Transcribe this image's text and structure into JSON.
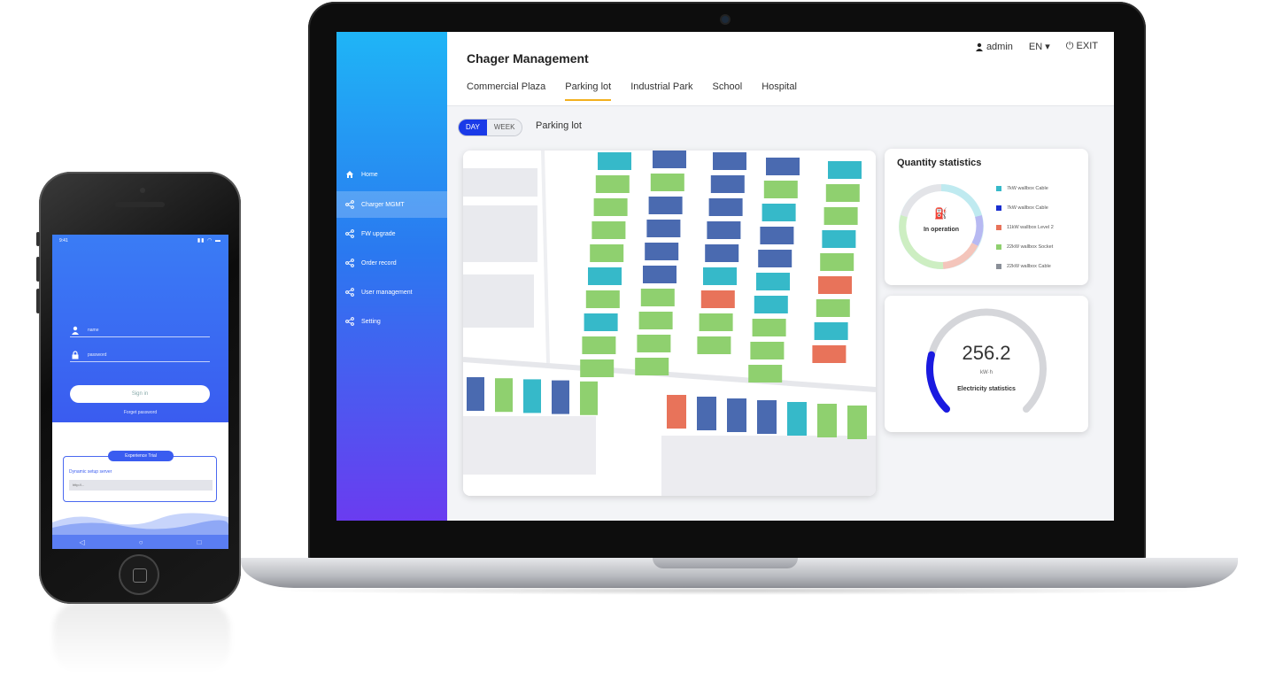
{
  "laptop": {
    "header": {
      "title": "Chager Management",
      "user": "admin",
      "language": "EN",
      "exit_label": "EXIT"
    },
    "tabs": [
      "Commercial Plaza",
      "Parking lot",
      "Industrial Park",
      "School",
      "Hospital"
    ],
    "active_tab": "Parking lot",
    "sidebar": {
      "items": [
        {
          "label": "Home",
          "icon": "home-icon"
        },
        {
          "label": "Charger MGMT",
          "icon": "share-icon"
        },
        {
          "label": "FW upgrade",
          "icon": "share-icon"
        },
        {
          "label": "Order record",
          "icon": "share-icon"
        },
        {
          "label": "User management",
          "icon": "share-icon"
        },
        {
          "label": "Setting",
          "icon": "share-icon"
        }
      ],
      "active_item": "Charger MGMT"
    },
    "filter": {
      "day_label": "DAY",
      "week_label": "WEEK",
      "selected": "DAY",
      "location_label": "Parking lot"
    },
    "quantity_stats": {
      "title": "Quantity statistics",
      "center_label": "In operation",
      "legend": [
        {
          "label": "7kW wallbox Cable",
          "color": "#36b9c9"
        },
        {
          "label": "7kW wallbox Cable",
          "color": "#1a2fd0"
        },
        {
          "label": "11kW wallbox Level 2",
          "color": "#e8735a"
        },
        {
          "label": "22kW wallbox Socket",
          "color": "#8fd06f"
        },
        {
          "label": "22kW wallbox Cable",
          "color": "#8a8f98"
        }
      ]
    },
    "electricity": {
      "value": "256.2",
      "unit": "kW·h",
      "label": "Electricity statistics",
      "fill_fraction": 0.22
    },
    "colors": {
      "accent_tab": "#f2b01e",
      "toggle_on": "#1a3ae8",
      "spot_teal": "#36b9c9",
      "spot_green": "#8fd06f",
      "spot_blue": "#4a6ab0",
      "spot_red": "#e8735a"
    }
  },
  "phone": {
    "username_placeholder": "name",
    "password_placeholder": "password",
    "signin_label": "Sign in",
    "forgot_label": "Forget password",
    "experience_label": "Experience Trial",
    "dynamic_label": "Dynamic setup server",
    "server_input": "http://...",
    "nav": [
      "◁",
      "○",
      "□"
    ]
  }
}
